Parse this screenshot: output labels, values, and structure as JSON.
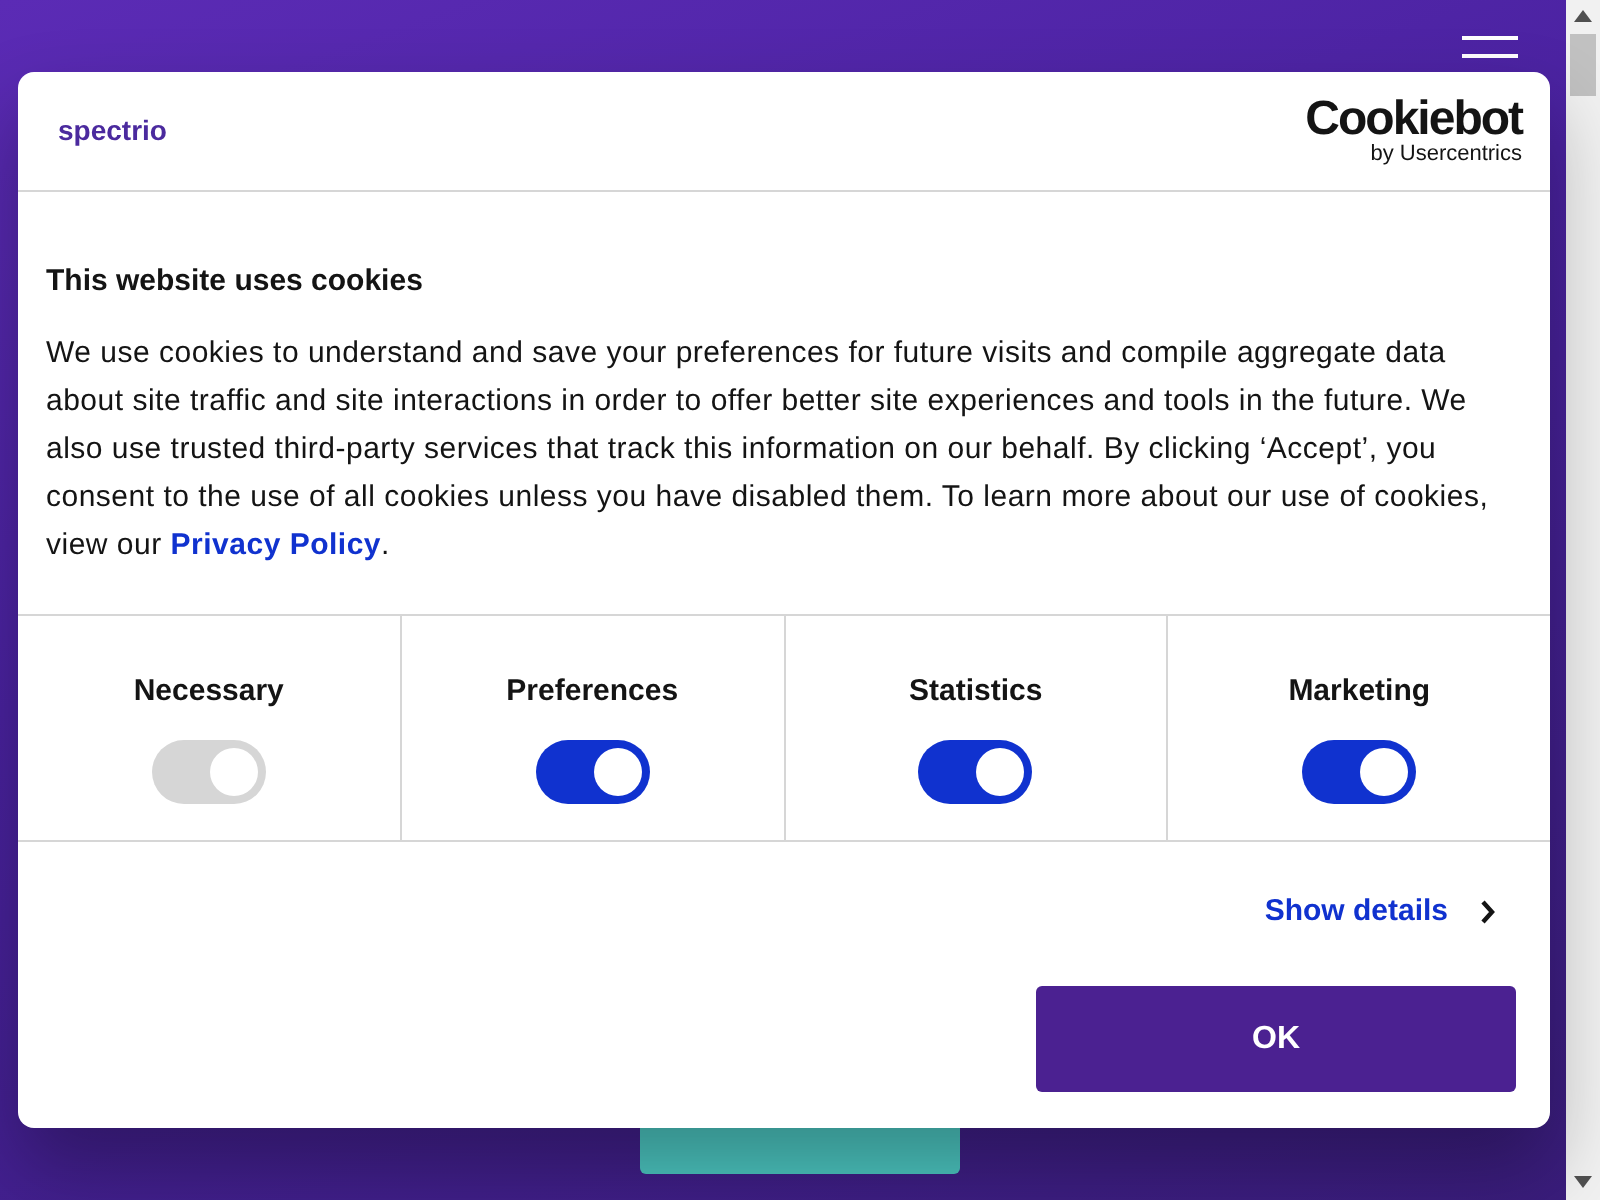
{
  "dialog": {
    "brand": "spectrio",
    "provider": "Cookiebot",
    "provider_sub": "by Usercentrics",
    "title": "This website uses cookies",
    "text_before": "We use cookies to understand and save your preferences for future visits and compile aggregate data about site traffic and site interactions in order to offer better site experiences and tools in the future. We also use trusted third-party services that track this information on our behalf. By clicking ‘Accept’, you consent to the use of all cookies unless you have disabled them. To learn more about our use of cookies, view our ",
    "link": "Privacy Policy",
    "text_after": ".",
    "categories": [
      {
        "name": "Necessary",
        "checked": true,
        "disabled": true
      },
      {
        "name": "Preferences",
        "checked": true,
        "disabled": false
      },
      {
        "name": "Statistics",
        "checked": true,
        "disabled": false
      },
      {
        "name": "Marketing",
        "checked": true,
        "disabled": false
      }
    ],
    "details_link": "Show details",
    "ok_button": "OK"
  }
}
